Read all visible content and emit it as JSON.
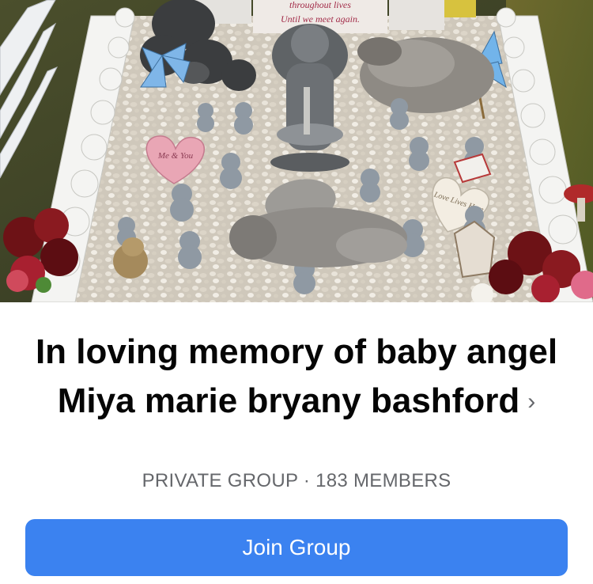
{
  "cover_photo": {
    "plaque_text_line1": "throughout lives",
    "plaque_text_line2": "Until we meet again.",
    "heart_left_text": "Me & You",
    "heart_right_text": "Love Lives Here"
  },
  "group": {
    "title": "In loving memory of baby angel  Miya marie bryany bashford",
    "chevron": "›",
    "privacy": "PRIVATE GROUP",
    "separator": "·",
    "members": "183 MEMBERS"
  },
  "actions": {
    "join_label": "Join Group"
  },
  "colors": {
    "join_button": "#3b82f0",
    "title_text": "#050505",
    "meta_text": "#65676b"
  }
}
